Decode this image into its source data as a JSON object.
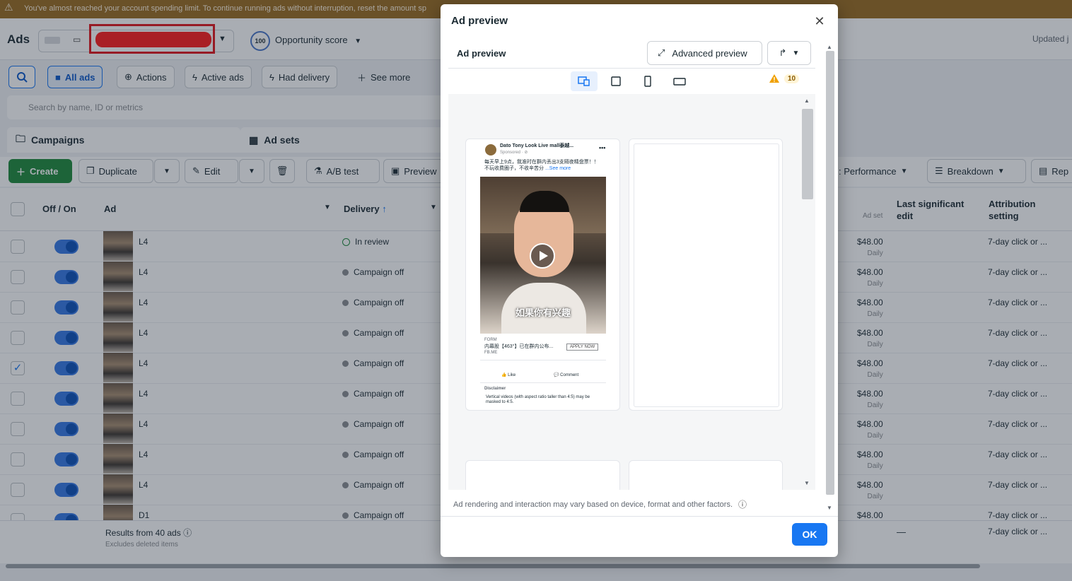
{
  "banner": {
    "text": "You've almost reached your account spending limit. To continue running ads without interruption, reset the amount sp"
  },
  "header": {
    "title": "Ads",
    "opportunity_score": "100",
    "opportunity_label": "Opportunity score",
    "updated_label": "Updated j"
  },
  "filters": {
    "all_ads": "All ads",
    "actions": "Actions",
    "active_ads": "Active ads",
    "had_delivery": "Had delivery",
    "see_more": "See more",
    "search_placeholder": "Search by name, ID or metrics"
  },
  "levels": {
    "campaigns": "Campaigns",
    "ad_sets": "Ad sets"
  },
  "toolbar": {
    "create": "Create",
    "duplicate": "Duplicate",
    "edit": "Edit",
    "ab_test": "A/B test",
    "preview": "Preview",
    "performance": ": Performance",
    "breakdown": "Breakdown",
    "reports": "Rep"
  },
  "table": {
    "headers": {
      "off_on": "Off / On",
      "ad": "Ad",
      "delivery": "Delivery",
      "adset_sub": "Ad set",
      "last_edit": "Last significant edit",
      "attribution": "Attribution setting"
    },
    "rows": [
      {
        "name": "L4",
        "delivery": "In review",
        "budget": "$48.00",
        "budget_period": "Daily",
        "attribution": "7-day click or ...",
        "checked": false
      },
      {
        "name": "L4",
        "delivery": "Campaign off",
        "budget": "$48.00",
        "budget_period": "Daily",
        "attribution": "7-day click or ...",
        "checked": false
      },
      {
        "name": "L4",
        "delivery": "Campaign off",
        "budget": "$48.00",
        "budget_period": "Daily",
        "attribution": "7-day click or ...",
        "checked": false
      },
      {
        "name": "L4",
        "delivery": "Campaign off",
        "budget": "$48.00",
        "budget_period": "Daily",
        "attribution": "7-day click or ...",
        "checked": false
      },
      {
        "name": "L4",
        "delivery": "Campaign off",
        "budget": "$48.00",
        "budget_period": "Daily",
        "attribution": "7-day click or ...",
        "checked": true
      },
      {
        "name": "L4",
        "delivery": "Campaign off",
        "budget": "$48.00",
        "budget_period": "Daily",
        "attribution": "7-day click or ...",
        "checked": false
      },
      {
        "name": "L4",
        "delivery": "Campaign off",
        "budget": "$48.00",
        "budget_period": "Daily",
        "attribution": "7-day click or ...",
        "checked": false
      },
      {
        "name": "L4",
        "delivery": "Campaign off",
        "budget": "$48.00",
        "budget_period": "Daily",
        "attribution": "7-day click or ...",
        "checked": false
      },
      {
        "name": "L4",
        "delivery": "Campaign off",
        "budget": "$48.00",
        "budget_period": "Daily",
        "attribution": "7-day click or ...",
        "checked": false
      },
      {
        "name": "D1",
        "delivery": "Campaign off",
        "budget": "$48.00",
        "budget_period": "",
        "attribution": "7-day click or ...",
        "checked": false
      }
    ],
    "footer": {
      "results": "Results from 40 ads",
      "excludes": "Excludes deleted items",
      "dash": "—",
      "attribution": "7-day click or ..."
    }
  },
  "modal": {
    "title": "Ad preview",
    "subtitle": "Ad preview",
    "advanced_preview": "Advanced preview",
    "warning_count": "10",
    "notice": "Ad rendering and interaction may vary based on device, format and other factors.",
    "ok": "OK",
    "post": {
      "page_name": "Dato Tony Look Live mall泰越...",
      "sponsored": "Sponsored · ⊘",
      "body": "每天早上9点，我准时在群内丢出3支隔夜精盘票！！不玩收费圈子，不收辛苦分",
      "see_more": "...See more",
      "subtitle_overlay": "如果你有兴趣",
      "cta_label": "FORM",
      "cta_title": "内幕股【463°】已在群内公布...",
      "cta_domain": "FB.ME",
      "cta_button": "APPLY NOW",
      "like": "Like",
      "comment": "Comment",
      "disclaimer_title": "Disclaimer",
      "disclaimer_text": "Vertical videos (with aspect ratio taller than 4:5) may be masked to 4:5."
    }
  },
  "colors": {
    "accent": "#1877f2",
    "create_green": "#1d8a3a",
    "banner": "#9a6b20",
    "warning": "#f0a000",
    "redaction": "#ff1a1a"
  }
}
